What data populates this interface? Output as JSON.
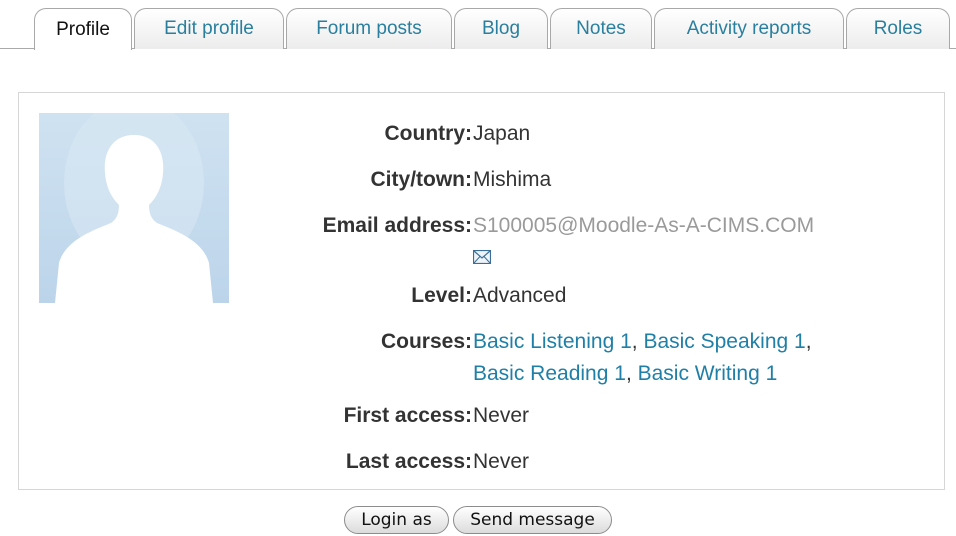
{
  "tabs": [
    {
      "label": "Profile",
      "active": true
    },
    {
      "label": "Edit profile"
    },
    {
      "label": "Forum posts"
    },
    {
      "label": "Blog"
    },
    {
      "label": "Notes"
    },
    {
      "label": "Activity reports"
    },
    {
      "label": "Roles"
    }
  ],
  "profile": {
    "avatar_icon": "default-user-silhouette",
    "country_label": "Country:",
    "country": "Japan",
    "city_label": "City/town:",
    "city": "Mishima",
    "email_label": "Email address:",
    "email": "S100005@Moodle-As-A-CIMS.COM",
    "email_icon": "envelope-icon",
    "level_label": "Level:",
    "level": "Advanced",
    "courses_label": "Courses:",
    "courses": [
      "Basic Listening 1",
      "Basic Speaking 1",
      "Basic Reading 1",
      "Basic Writing 1"
    ],
    "first_access_label": "First access:",
    "first_access": "Never",
    "last_access_label": "Last access:",
    "last_access": "Never"
  },
  "buttons": {
    "login_as": "Login as",
    "send_message": "Send message"
  },
  "colors": {
    "link": "#1f7fa6",
    "email_text": "#9a9a9a",
    "avatar_bg": "#c9ddef"
  }
}
